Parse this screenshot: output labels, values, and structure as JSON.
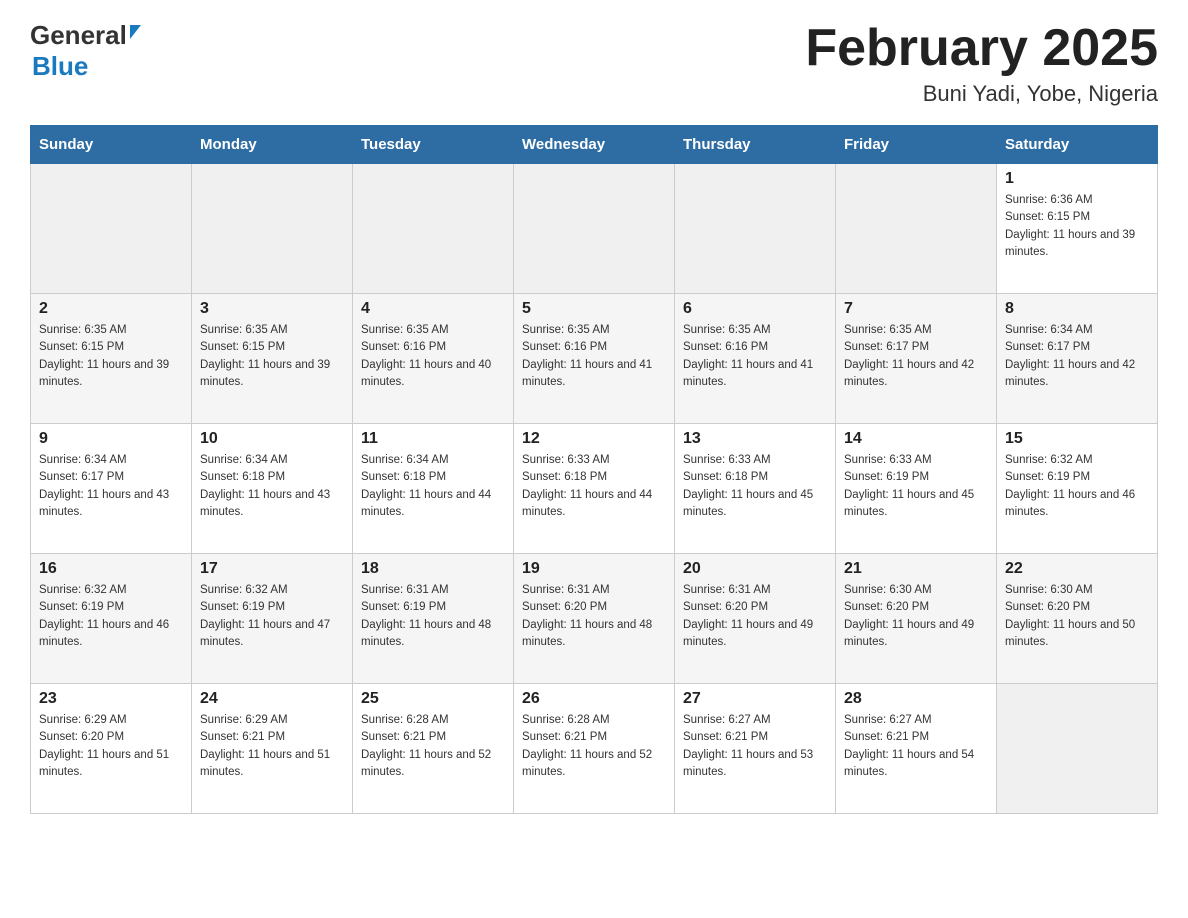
{
  "logo": {
    "general": "General",
    "blue": "Blue"
  },
  "title": "February 2025",
  "subtitle": "Buni Yadi, Yobe, Nigeria",
  "days_of_week": [
    "Sunday",
    "Monday",
    "Tuesday",
    "Wednesday",
    "Thursday",
    "Friday",
    "Saturday"
  ],
  "weeks": [
    [
      {
        "day": "",
        "info": ""
      },
      {
        "day": "",
        "info": ""
      },
      {
        "day": "",
        "info": ""
      },
      {
        "day": "",
        "info": ""
      },
      {
        "day": "",
        "info": ""
      },
      {
        "day": "",
        "info": ""
      },
      {
        "day": "1",
        "info": "Sunrise: 6:36 AM\nSunset: 6:15 PM\nDaylight: 11 hours and 39 minutes."
      }
    ],
    [
      {
        "day": "2",
        "info": "Sunrise: 6:35 AM\nSunset: 6:15 PM\nDaylight: 11 hours and 39 minutes."
      },
      {
        "day": "3",
        "info": "Sunrise: 6:35 AM\nSunset: 6:15 PM\nDaylight: 11 hours and 39 minutes."
      },
      {
        "day": "4",
        "info": "Sunrise: 6:35 AM\nSunset: 6:16 PM\nDaylight: 11 hours and 40 minutes."
      },
      {
        "day": "5",
        "info": "Sunrise: 6:35 AM\nSunset: 6:16 PM\nDaylight: 11 hours and 41 minutes."
      },
      {
        "day": "6",
        "info": "Sunrise: 6:35 AM\nSunset: 6:16 PM\nDaylight: 11 hours and 41 minutes."
      },
      {
        "day": "7",
        "info": "Sunrise: 6:35 AM\nSunset: 6:17 PM\nDaylight: 11 hours and 42 minutes."
      },
      {
        "day": "8",
        "info": "Sunrise: 6:34 AM\nSunset: 6:17 PM\nDaylight: 11 hours and 42 minutes."
      }
    ],
    [
      {
        "day": "9",
        "info": "Sunrise: 6:34 AM\nSunset: 6:17 PM\nDaylight: 11 hours and 43 minutes."
      },
      {
        "day": "10",
        "info": "Sunrise: 6:34 AM\nSunset: 6:18 PM\nDaylight: 11 hours and 43 minutes."
      },
      {
        "day": "11",
        "info": "Sunrise: 6:34 AM\nSunset: 6:18 PM\nDaylight: 11 hours and 44 minutes."
      },
      {
        "day": "12",
        "info": "Sunrise: 6:33 AM\nSunset: 6:18 PM\nDaylight: 11 hours and 44 minutes."
      },
      {
        "day": "13",
        "info": "Sunrise: 6:33 AM\nSunset: 6:18 PM\nDaylight: 11 hours and 45 minutes."
      },
      {
        "day": "14",
        "info": "Sunrise: 6:33 AM\nSunset: 6:19 PM\nDaylight: 11 hours and 45 minutes."
      },
      {
        "day": "15",
        "info": "Sunrise: 6:32 AM\nSunset: 6:19 PM\nDaylight: 11 hours and 46 minutes."
      }
    ],
    [
      {
        "day": "16",
        "info": "Sunrise: 6:32 AM\nSunset: 6:19 PM\nDaylight: 11 hours and 46 minutes."
      },
      {
        "day": "17",
        "info": "Sunrise: 6:32 AM\nSunset: 6:19 PM\nDaylight: 11 hours and 47 minutes."
      },
      {
        "day": "18",
        "info": "Sunrise: 6:31 AM\nSunset: 6:19 PM\nDaylight: 11 hours and 48 minutes."
      },
      {
        "day": "19",
        "info": "Sunrise: 6:31 AM\nSunset: 6:20 PM\nDaylight: 11 hours and 48 minutes."
      },
      {
        "day": "20",
        "info": "Sunrise: 6:31 AM\nSunset: 6:20 PM\nDaylight: 11 hours and 49 minutes."
      },
      {
        "day": "21",
        "info": "Sunrise: 6:30 AM\nSunset: 6:20 PM\nDaylight: 11 hours and 49 minutes."
      },
      {
        "day": "22",
        "info": "Sunrise: 6:30 AM\nSunset: 6:20 PM\nDaylight: 11 hours and 50 minutes."
      }
    ],
    [
      {
        "day": "23",
        "info": "Sunrise: 6:29 AM\nSunset: 6:20 PM\nDaylight: 11 hours and 51 minutes."
      },
      {
        "day": "24",
        "info": "Sunrise: 6:29 AM\nSunset: 6:21 PM\nDaylight: 11 hours and 51 minutes."
      },
      {
        "day": "25",
        "info": "Sunrise: 6:28 AM\nSunset: 6:21 PM\nDaylight: 11 hours and 52 minutes."
      },
      {
        "day": "26",
        "info": "Sunrise: 6:28 AM\nSunset: 6:21 PM\nDaylight: 11 hours and 52 minutes."
      },
      {
        "day": "27",
        "info": "Sunrise: 6:27 AM\nSunset: 6:21 PM\nDaylight: 11 hours and 53 minutes."
      },
      {
        "day": "28",
        "info": "Sunrise: 6:27 AM\nSunset: 6:21 PM\nDaylight: 11 hours and 54 minutes."
      },
      {
        "day": "",
        "info": ""
      }
    ]
  ]
}
